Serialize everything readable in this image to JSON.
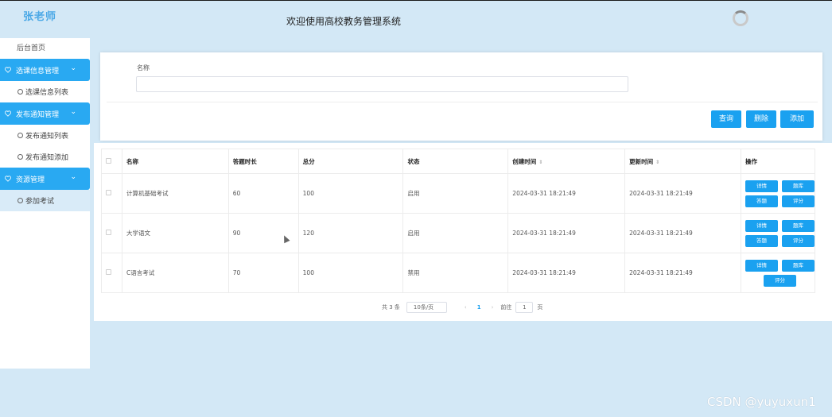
{
  "header": {
    "user": "张老师",
    "title": "欢迎使用高校教务管理系统"
  },
  "sidebar": {
    "home": "后台首页",
    "groups": [
      {
        "label": "选课信息管理",
        "items": [
          "选课信息列表"
        ]
      },
      {
        "label": "发布通知管理",
        "items": [
          "发布通知列表",
          "发布通知添加"
        ]
      },
      {
        "label": "资源管理",
        "items": [
          "参加考试"
        ]
      }
    ]
  },
  "search": {
    "label": "名称",
    "value": "",
    "placeholder": ""
  },
  "buttons": {
    "query": "查询",
    "delete": "删除",
    "add": "添加"
  },
  "table": {
    "headers": [
      "名称",
      "答题时长",
      "总分",
      "状态",
      "创建时间",
      "更新时间",
      "操作"
    ],
    "rows": [
      {
        "name": "计算机基础考试",
        "duration": "60",
        "score": "100",
        "status": "启用",
        "created": "2024-03-31 18:21:49",
        "updated": "2024-03-31 18:21:49",
        "ops": [
          "详情",
          "题库",
          "答题",
          "评分"
        ]
      },
      {
        "name": "大学语文",
        "duration": "90",
        "score": "120",
        "status": "启用",
        "created": "2024-03-31 18:21:49",
        "updated": "2024-03-31 18:21:49",
        "ops": [
          "详情",
          "题库",
          "答题",
          "评分"
        ]
      },
      {
        "name": "C语言考试",
        "duration": "70",
        "score": "100",
        "status": "禁用",
        "created": "2024-03-31 18:21:49",
        "updated": "2024-03-31 18:21:49",
        "ops": [
          "详情",
          "题库",
          "评分"
        ]
      }
    ]
  },
  "pagination": {
    "total": "共 3 条",
    "page_size": "10条/页",
    "current": "1",
    "goto_prefix": "前往",
    "goto_value": "1",
    "goto_suffix": "页",
    "prev": "‹",
    "next": "›"
  },
  "watermark": "CSDN @yuyuxun1",
  "colors": {
    "accent": "#1aa1f0",
    "sidebar_group": "#29a9f2",
    "background": "#d3e8f6"
  }
}
